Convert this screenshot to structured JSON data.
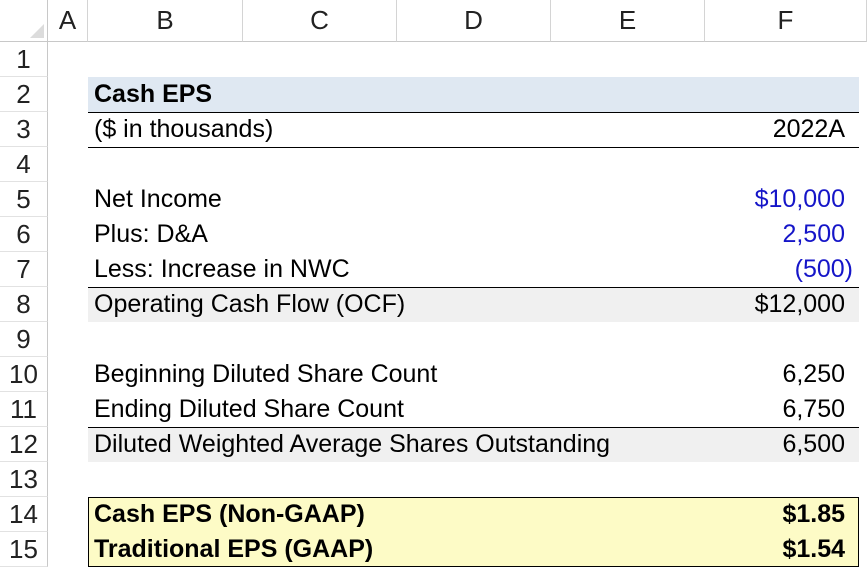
{
  "columns": [
    "A",
    "B",
    "C",
    "D",
    "E",
    "F"
  ],
  "rows": [
    "1",
    "2",
    "3",
    "4",
    "5",
    "6",
    "7",
    "8",
    "9",
    "10",
    "11",
    "12",
    "13",
    "14",
    "15"
  ],
  "model": {
    "title": "Cash EPS",
    "units": "($ in thousands)",
    "period": "2022A",
    "net_income_label": "Net Income",
    "net_income_value": "$10,000",
    "da_label": "Plus: D&A",
    "da_value": "2,500",
    "nwc_label": "Less: Increase in NWC",
    "nwc_value": "(500)",
    "ocf_label": "Operating Cash Flow (OCF)",
    "ocf_value": "$12,000",
    "beg_shares_label": "Beginning Diluted Share Count",
    "beg_shares_value": "6,250",
    "end_shares_label": "Ending Diluted Share Count",
    "end_shares_value": "6,750",
    "wavg_label": "Diluted Weighted Average Shares Outstanding",
    "wavg_value": "6,500",
    "cash_eps_label": "Cash EPS (Non-GAAP)",
    "cash_eps_value": "$1.85",
    "trad_eps_label": "Traditional EPS (GAAP)",
    "trad_eps_value": "$1.54"
  },
  "colors": {
    "input_blue": "#1515c8",
    "title_band": "#dfe8f2",
    "total_band": "#f0f0f0",
    "result_band": "#fdfbc6"
  }
}
